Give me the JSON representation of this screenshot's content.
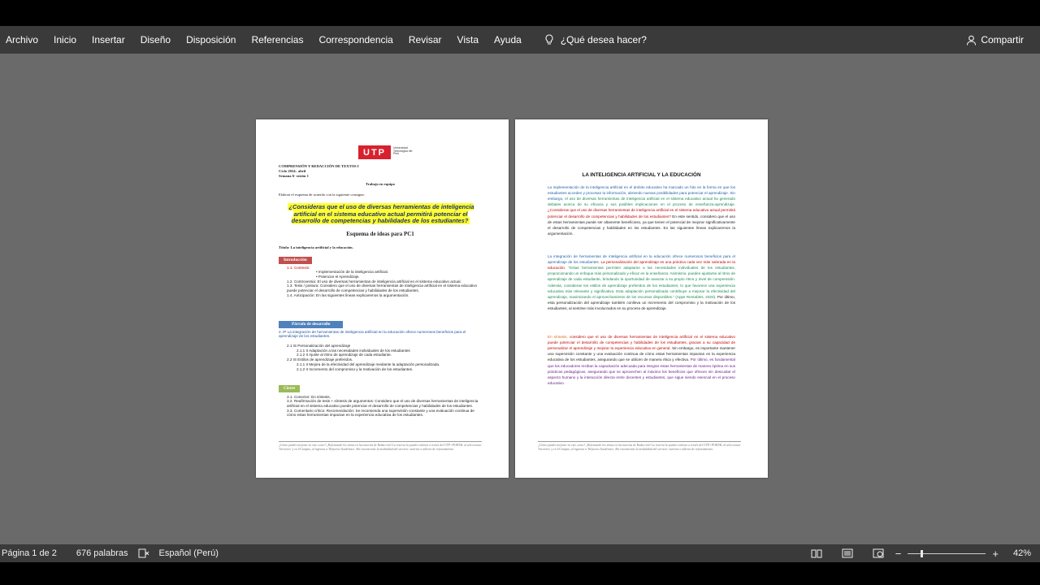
{
  "ribbon": {
    "tabs": [
      "Archivo",
      "Inicio",
      "Insertar",
      "Diseño",
      "Disposición",
      "Referencias",
      "Correspondencia",
      "Revisar",
      "Vista",
      "Ayuda"
    ],
    "tell_me": "¿Qué desea hacer?",
    "share": "Compartir"
  },
  "page1": {
    "logo_text": "UTP",
    "logo_sub": "Universidad Tecnológica del Perú",
    "course": "COMPRENSIÓN Y REDACCIÓN DE TEXTOS I",
    "cycle": "Ciclo 2024– abril",
    "week": "Semana 6- sesión 1",
    "team": "Trabajo en equipo",
    "instruction": "Elabora el esquema de acuerdo con la siguiente consigna:",
    "question": "¿Consideras que el uso de diversas herramientas de inteligencia artificial en el sistema educativo actual permitirá potenciar el desarrollo de competencias y habilidades de los estudiantes?",
    "scheme_title": "Esquema de ideas para PC1",
    "topic": "Título: La inteligencia artificial y la educación.",
    "intro_label": "Introducción",
    "intro_lines": [
      "1.1.        Contexto:",
      "•    Implementación de la inteligencia artificial.",
      "•    Potenciar el Aprendizaje.",
      "1.2.     Controversia: El uso de diversas herramientas de inteligencia artificial en el sistema educativo actual.",
      "1.3.     Tesis / postura: Considero que el uso de diversas herramientas de inteligencia artificial en el sistema educativo puede potenciar el desarrollo de competencias y habilidades de los estudiantes.",
      "1.4.     Anticipación: En las siguientes líneas explicaremos la argumentación."
    ],
    "body_label": "Párrafo de desarrollo",
    "body_lines": [
      "2. IP La integración de herramientas de inteligencia artificial en la educación ofrece numerosos beneficios para el aprendizaje de los estudiantes.",
      "2.1 IS Personalización del aprendizaje",
      "2.1.1 II Adaptación a las necesidades individuales de los estudiantes",
      "2.1.2 II Ajuste al ritmo de aprendizaje de cada estudiante.",
      "2.2 IS Estilos de aprendizaje preferidos.",
      "2.1.1 II Mejora de la efectividad del aprendizaje mediante la adaptación personalizada.",
      "2.1.2 II Incremento del compromiso y la motivación de los estudiantes."
    ],
    "close_label": "Cierre",
    "close_lines": [
      "3.1. Conector: En síntesis,",
      "3.2. Reafirmación de tesis + síntesis de argumentos: Considero que el uso de diversas herramientas de inteligencia artificial en el sistema educativo puede potenciar el desarrollo de competencias y habilidades de los estudiantes.",
      "3.3. Comentario crítico: Recomendación: Se recomienda una supervisión constante y una evaluación continua de cómo estas herramientas impactan en la experiencia educativa de los estudiantes."
    ],
    "footer": "¿Cómo puedes mejorar en este curso? ¡Reforzando los temas en las tutorías de Redacción! La reserva la puedes realizar a través del UTP+PORTAL al seleccionar 'Servicios' y en UCampus, al ingresar a 'Refuerzo Académico. Ahí encontrarás la modalidad del servicio: tutorías o talleres de reforzamiento."
  },
  "page2": {
    "title": "LA INTELIGENCIA ARTIFICIAL Y LA EDUCACIÓN",
    "para1": [
      {
        "c": "c-blue",
        "t": "La implementación de la inteligencia artificial en el ámbito educativo ha marcado un hito en la forma en que los estudiantes acceden y procesan la información, abriendo nuevas posibilidades para potenciar el aprendizaje. Sin embargo, "
      },
      {
        "c": "c-green",
        "t": "el uso de diversas herramientas de inteligencia artificial en el sistema educativo actual ha generado debates acerca de su eficacia y sus posibles implicaciones en el proceso de enseñanza-aprendizaje. "
      },
      {
        "c": "c-red",
        "t": "¿Consideras que el uso de diversas herramientas de inteligencia artificial en el sistema educativo actual permitirá potenciar el desarrollo de competencias y habilidades de los estudiantes? "
      },
      {
        "c": "c-dark",
        "t": "En este sentido, considero que el uso de estas herramientas puede ser altamente beneficioso, ya que tienen el potencial de mejorar significativamente el desarrollo de competencias y habilidades en los estudiantes. En las siguientes líneas explicaremos la argumentación."
      }
    ],
    "para2": [
      {
        "c": "c-blue",
        "t": "La integración de herramientas de inteligencia artificial en la educación ofrece numerosos beneficios para el aprendizaje de los estudiantes. "
      },
      {
        "c": "c-red",
        "t": "La personalización del aprendizaje es una práctica cada vez más valorada en la educación. "
      },
      {
        "c": "c-green",
        "t": "\"Estas herramientas permiten adaptarse a las necesidades individuales de los estudiantes, proporcionando un enfoque más personalizado y eficaz en la enseñanza. Asimismo, pueden ajustarse al ritmo de aprendizaje de cada estudiante, brindando la oportunidad de avanzar a su propio ritmo y nivel de comprensión. Además, consideran los estilos de aprendizaje preferidos de los estudiantes, lo que favorece una experiencia educativa más relevante y significativa. Esta adaptación personalizada contribuye a mejorar la efectividad del aprendizaje, maximizando el aprovechamiento de los recursos disponibles.\" (Apps Rentables, 2020). "
      },
      {
        "c": "c-dark",
        "t": "Por último, esta personalización del aprendizaje también conlleva un incremento del compromiso y la motivación de los estudiantes, al sentirse más involucrados en su proceso de aprendizaje."
      }
    ],
    "para3": [
      {
        "c": "c-orange",
        "t": "En síntesis, "
      },
      {
        "c": "c-red",
        "t": "considero que el uso de diversas herramientas de inteligencia artificial en el sistema educativo puede potenciar el desarrollo de competencias y habilidades de los estudiantes, gracias a su capacidad de personalizar el aprendizaje y mejorar la experiencia educativa en general. "
      },
      {
        "c": "c-dark",
        "t": "Sin embargo, es importante mantener una supervisión constante y una evaluación continua de cómo estas herramientas impactan en la experiencia educativa de los estudiantes, asegurando que se utilicen de manera ética y efectiva. "
      },
      {
        "c": "c-purple",
        "t": "Por último, es fundamental que los educadores reciban la capacitación adecuada para integrar estas herramientas de manera óptima en sus prácticas pedagógicas, asegurando que se aprovechen al máximo los beneficios que ofrecen sin descuidar el aspecto humano y la interacción directa entre docentes y estudiantes, que sigue siendo esencial en el proceso educativo."
      }
    ],
    "footer": "¿Cómo puedes mejorar en este curso? ¡Reforzando los temas en las tutorías de Redacción! La reserva la puedes realizar a través del UTP+PORTAL al seleccionar 'Servicios' y en UCampus, al ingresar a 'Refuerzo Académico. Ahí encontrarás la modalidad del servicio: tutorías o talleres de reforzamiento."
  },
  "status": {
    "page": "Página 1 de 2",
    "words": "676 palabras",
    "language": "Español (Perú)",
    "zoom": "42%",
    "zoom_level": 0.42
  },
  "icons": [
    "lightbulb-icon",
    "person-icon",
    "proofing-icon",
    "read-mode-icon",
    "print-layout-icon",
    "web-layout-icon"
  ]
}
